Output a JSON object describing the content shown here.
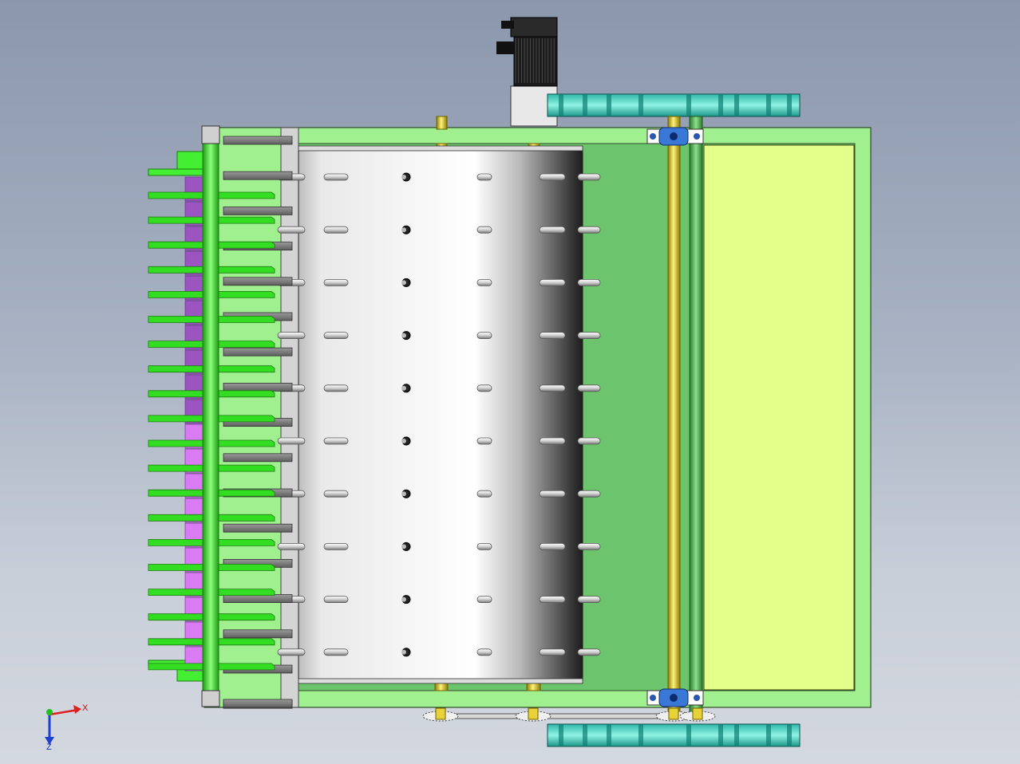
{
  "view": {
    "background_top": "#8b97ad",
    "background_bottom": "#d3d8e0"
  },
  "model": {
    "pin_rows": 10,
    "pin_columns": 7,
    "rake_tines": 20,
    "colors": {
      "frame": "#a0f090",
      "frame_edge": "#2f4a2a",
      "rake": "#33dd22",
      "rake_edge": "#1e7a12",
      "purple_dark": "#9b55c0",
      "purple_light": "#d97bf2",
      "drum_light": "#ffffff",
      "drum_dark": "#1c1c1c",
      "green_panel": "#6cc46c",
      "yellow_panel": "#e4ff8a",
      "shaft": "#e7d23a",
      "shaft_edge": "#6f6000",
      "pulley": "#3fd0bf",
      "pulley_dark": "#0e7d72",
      "bearing": "#3a78d8",
      "motor": "#1a1a1a",
      "plate_gray": "#7f7f7f"
    }
  },
  "triad": {
    "x_label": "X",
    "z_label": "Z",
    "x_color": "#e02020",
    "y_color": "#20c020",
    "z_color": "#2040d0"
  }
}
